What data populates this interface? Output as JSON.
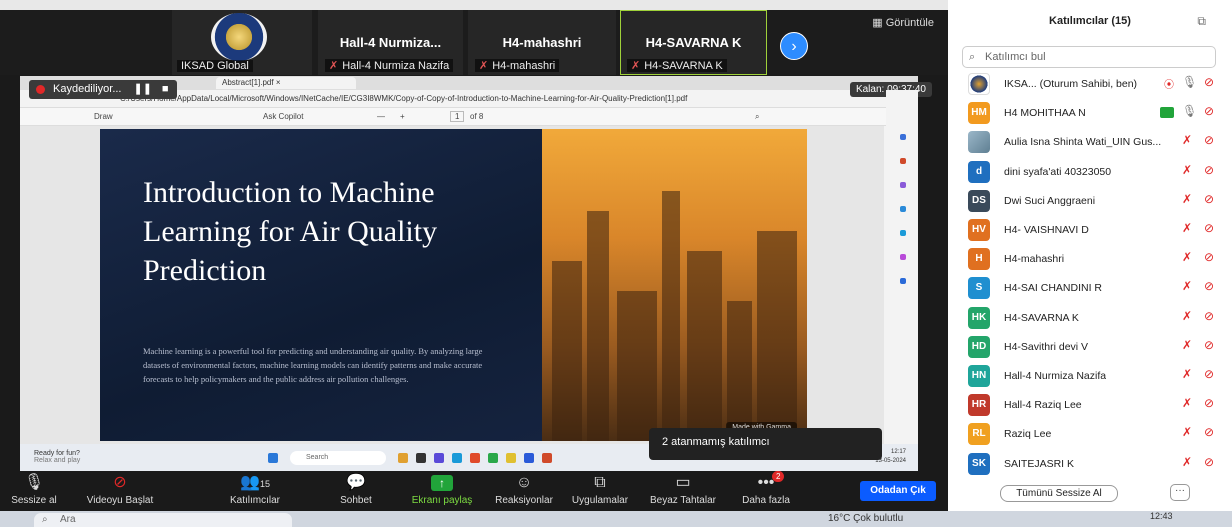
{
  "gallery": {
    "logo_tile_name": "IKSAD Global",
    "tiles": [
      {
        "title": "Hall-4  Nurmiza...",
        "name": "Hall-4 Nurmiza Nazifa"
      },
      {
        "title": "H4-mahashri",
        "name": "H4-mahashri"
      },
      {
        "title": "H4-SAVARNA K",
        "name": "H4-SAVARNA K"
      }
    ],
    "view_label": "Görüntüle"
  },
  "recording": {
    "label": "Kaydediliyor..."
  },
  "timer": {
    "label": "Kalan: 09:37:40"
  },
  "browser": {
    "tab1": "Abstract[1].pdf",
    "address": "C:/Users/Home/AppData/Local/Microsoft/Windows/INetCache/IE/CG3I8WMK/Copy-of-Copy-of-Introduction-to-Machine-Learning-for-Air-Quality-Prediction[1].pdf",
    "toolbar_draw": "Draw",
    "toolbar_copilot": "Ask Copilot",
    "page_current": "1",
    "page_of": "of 8"
  },
  "slide": {
    "title": "Introduction to Machine Learning for Air Quality Prediction",
    "body": "Machine learning is a powerful tool for predicting and understanding air quality. By analyzing large datasets of environmental factors, machine learning models can identify patterns and make accurate forecasts to help policymakers and the public address air pollution challenges.",
    "watermark": "Made with Gamma"
  },
  "inner_taskbar": {
    "weather_title": "Ready for fun?",
    "weather_sub": "Relax and play",
    "search": "Search",
    "lang": "IN",
    "time": "12:17",
    "date": "13-05-2024"
  },
  "tooltip": {
    "text": "2 atanmamış katılımcı"
  },
  "controls": {
    "mute": "Sessize al",
    "video": "Videoyu Başlat",
    "participants": "Katılımcılar",
    "participants_count": "15",
    "chat": "Sohbet",
    "share": "Ekranı paylaş",
    "reactions": "Reaksiyonlar",
    "apps": "Uygulamalar",
    "whiteboards": "Beyaz Tahtalar",
    "more": "Daha fazla",
    "more_badge": "2",
    "leave": "Odadan Çık"
  },
  "winbar": {
    "search": "Ara",
    "weather": "16°C  Çok bulutlu",
    "clock": "12:43"
  },
  "panel": {
    "title": "Katılımcılar (15)",
    "search_placeholder": "Katılımcı bul",
    "participants": [
      {
        "initials": "",
        "name": "IKSA...  (Oturum Sahibi, ben)",
        "color": "#ffffff"
      },
      {
        "initials": "HM",
        "name": "H4 MOHITHAA N",
        "color": "#f29a1f"
      },
      {
        "initials": "",
        "name": "Aulia Isna Shinta Wati_UIN Gus...",
        "color": "#7aa0b8"
      },
      {
        "initials": "d",
        "name": "dini syafa'ati 40323050",
        "color": "#1f6fbf"
      },
      {
        "initials": "DS",
        "name": "Dwi Suci Anggraeni",
        "color": "#3a4a5a"
      },
      {
        "initials": "HV",
        "name": "H4- VAISHNAVI D",
        "color": "#e07020"
      },
      {
        "initials": "H",
        "name": "H4-mahashri",
        "color": "#e07020"
      },
      {
        "initials": "S",
        "name": "H4-SAI CHANDINI R",
        "color": "#1f8fd0"
      },
      {
        "initials": "HK",
        "name": "H4-SAVARNA K",
        "color": "#23a56a"
      },
      {
        "initials": "HD",
        "name": "H4-Savithri devi V",
        "color": "#23a56a"
      },
      {
        "initials": "HN",
        "name": "Hall-4 Nurmiza Nazifa",
        "color": "#1fa59a"
      },
      {
        "initials": "HR",
        "name": "Hall-4 Raziq Lee",
        "color": "#c0392b"
      },
      {
        "initials": "RL",
        "name": "Raziq Lee",
        "color": "#f0a020"
      },
      {
        "initials": "SK",
        "name": "SAITEJASRI K",
        "color": "#1f6fbf"
      }
    ],
    "mute_all": "Tümünü Sessize Al",
    "more": "···"
  },
  "icons": {
    "mic_muted": "mic-muted-icon",
    "cam_off": "camera-off-icon",
    "search": "search-icon"
  }
}
